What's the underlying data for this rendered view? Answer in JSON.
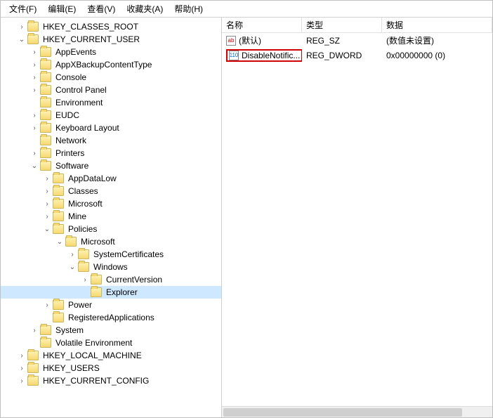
{
  "menu": {
    "file": "文件(F)",
    "edit": "编辑(E)",
    "view": "查看(V)",
    "favorites": "收藏夹(A)",
    "help": "帮助(H)"
  },
  "list": {
    "headers": {
      "name": "名称",
      "type": "类型",
      "data": "数据"
    },
    "rows": [
      {
        "icon": "str",
        "name": "(默认)",
        "type": "REG_SZ",
        "data": "(数值未设置)",
        "highlight": false
      },
      {
        "icon": "bin",
        "name": "DisableNotific...",
        "type": "REG_DWORD",
        "data": "0x00000000 (0)",
        "highlight": true
      }
    ]
  },
  "tree": [
    {
      "depth": 1,
      "toggle": ">",
      "label": "HKEY_CLASSES_ROOT"
    },
    {
      "depth": 1,
      "toggle": "v",
      "label": "HKEY_CURRENT_USER"
    },
    {
      "depth": 2,
      "toggle": ">",
      "label": "AppEvents"
    },
    {
      "depth": 2,
      "toggle": ">",
      "label": "AppXBackupContentType"
    },
    {
      "depth": 2,
      "toggle": ">",
      "label": "Console"
    },
    {
      "depth": 2,
      "toggle": ">",
      "label": "Control Panel"
    },
    {
      "depth": 2,
      "toggle": "",
      "label": "Environment"
    },
    {
      "depth": 2,
      "toggle": ">",
      "label": "EUDC"
    },
    {
      "depth": 2,
      "toggle": ">",
      "label": "Keyboard Layout"
    },
    {
      "depth": 2,
      "toggle": "",
      "label": "Network"
    },
    {
      "depth": 2,
      "toggle": ">",
      "label": "Printers"
    },
    {
      "depth": 2,
      "toggle": "v",
      "label": "Software"
    },
    {
      "depth": 3,
      "toggle": ">",
      "label": "AppDataLow"
    },
    {
      "depth": 3,
      "toggle": ">",
      "label": "Classes"
    },
    {
      "depth": 3,
      "toggle": ">",
      "label": "Microsoft"
    },
    {
      "depth": 3,
      "toggle": ">",
      "label": "Mine"
    },
    {
      "depth": 3,
      "toggle": "v",
      "label": "Policies"
    },
    {
      "depth": 4,
      "toggle": "v",
      "label": "Microsoft"
    },
    {
      "depth": 5,
      "toggle": ">",
      "label": "SystemCertificates"
    },
    {
      "depth": 5,
      "toggle": "v",
      "label": "Windows"
    },
    {
      "depth": 6,
      "toggle": ">",
      "label": "CurrentVersion"
    },
    {
      "depth": 6,
      "toggle": "",
      "label": "Explorer",
      "selected": true
    },
    {
      "depth": 3,
      "toggle": ">",
      "label": "Power"
    },
    {
      "depth": 3,
      "toggle": "",
      "label": "RegisteredApplications"
    },
    {
      "depth": 2,
      "toggle": ">",
      "label": "System"
    },
    {
      "depth": 2,
      "toggle": "",
      "label": "Volatile Environment"
    },
    {
      "depth": 1,
      "toggle": ">",
      "label": "HKEY_LOCAL_MACHINE"
    },
    {
      "depth": 1,
      "toggle": ">",
      "label": "HKEY_USERS"
    },
    {
      "depth": 1,
      "toggle": ">",
      "label": "HKEY_CURRENT_CONFIG"
    }
  ],
  "icons": {
    "str": "ab",
    "bin": "110"
  }
}
